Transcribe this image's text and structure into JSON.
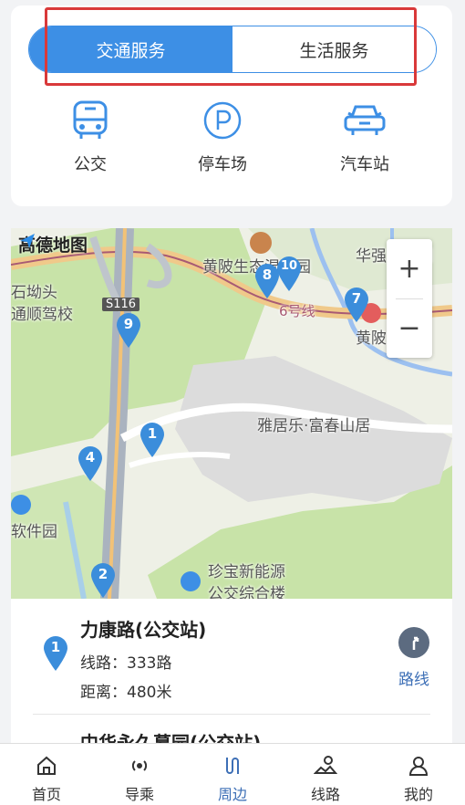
{
  "segmented": {
    "tabs": [
      {
        "label": "交通服务",
        "active": true
      },
      {
        "label": "生活服务",
        "active": false
      }
    ]
  },
  "categories": [
    {
      "label": "公交",
      "icon": "bus-icon"
    },
    {
      "label": "停车场",
      "icon": "parking-icon"
    },
    {
      "label": "汽车站",
      "icon": "car-icon"
    }
  ],
  "map": {
    "logo": "高德地图",
    "labels": {
      "a": "黄陂生态湿地园",
      "b": "华强工业园",
      "c": "石坳头",
      "d": "通顺驾校",
      "e": "S116",
      "f": "6号线",
      "g": "黄陂",
      "h": "雅居乐·富春山居",
      "i": "软件园",
      "j": "珍宝新能源",
      "k": "公交综合楼"
    },
    "zoom_in": "+",
    "zoom_out": "−",
    "pins": [
      "1",
      "2",
      "4",
      "7",
      "8",
      "9",
      "10"
    ]
  },
  "results": [
    {
      "index": "1",
      "title": "力康路(公交站)",
      "line": "线路：333路",
      "distance": "距离：480米",
      "route_label": "路线"
    },
    {
      "title": "中华永久墓园(公交站)"
    }
  ],
  "tabbar": [
    {
      "label": "首页",
      "icon": "home-icon",
      "active": false
    },
    {
      "label": "导乘",
      "icon": "signal-icon",
      "active": false
    },
    {
      "label": "周边",
      "icon": "route-icon",
      "active": true
    },
    {
      "label": "线路",
      "icon": "map-icon",
      "active": false
    },
    {
      "label": "我的",
      "icon": "user-icon",
      "active": false
    }
  ],
  "colors": {
    "accent": "#3d8fe5",
    "highlight_box": "#d9393a",
    "pin": "#3b8ddb"
  }
}
